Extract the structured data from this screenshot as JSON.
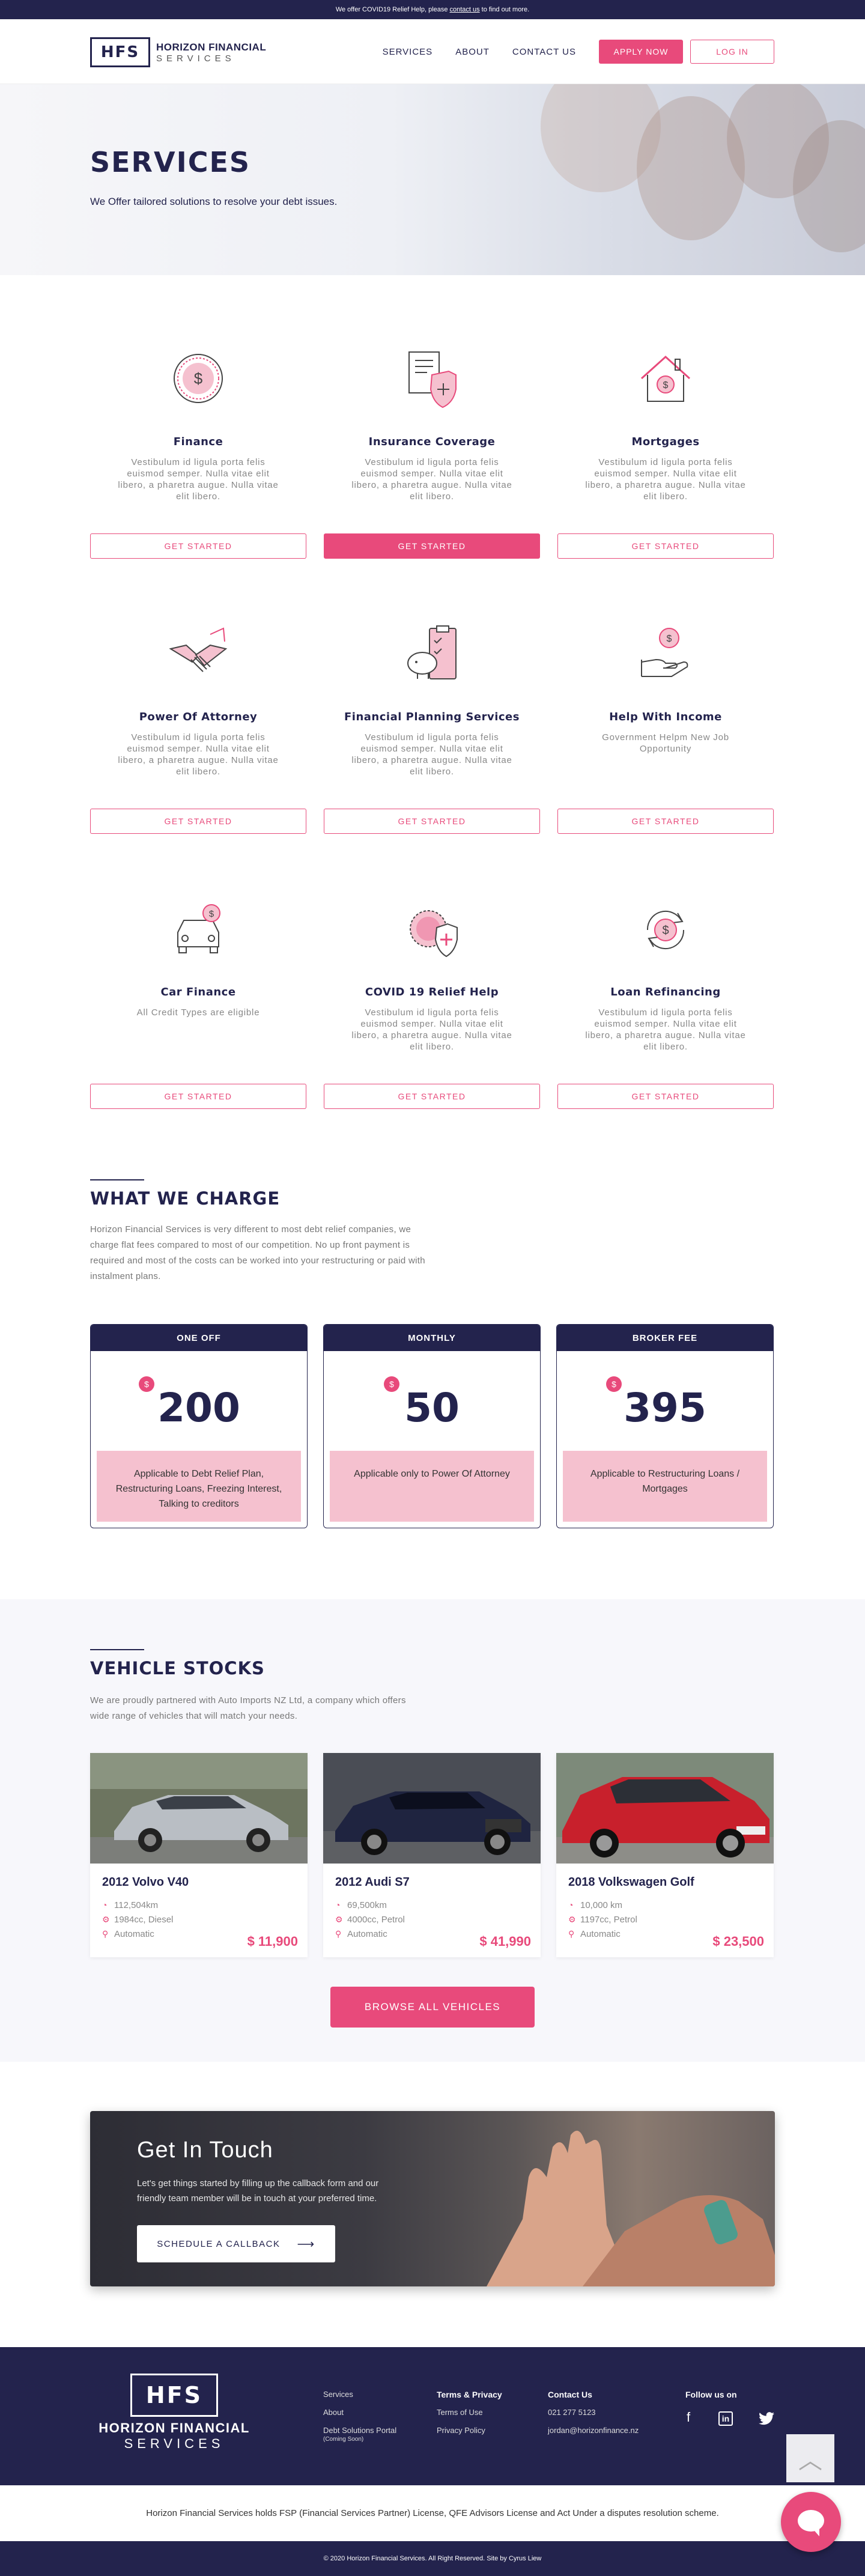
{
  "topbar": {
    "pre": "We offer COVID19 Relief Help, please",
    "link": "contact us",
    "post": "to find out more."
  },
  "header": {
    "logo_mark": "HFS",
    "logo_line1": "HORIZON FINANCIAL",
    "logo_line2": "SERVICES",
    "nav": [
      "SERVICES",
      "ABOUT",
      "CONTACT US"
    ],
    "apply": "APPLY NOW",
    "login": "LOG IN"
  },
  "hero": {
    "title": "SERVICES",
    "subtitle": "We Offer tailored solutions to resolve your debt issues."
  },
  "services": [
    {
      "title": "Finance",
      "text": "Vestibulum id ligula porta felis euismod semper. Nulla vitae elit libero, a pharetra augue. Nulla vitae elit libero.",
      "button": "GET STARTED",
      "icon": "coin-dollar-icon"
    },
    {
      "title": "Insurance Coverage",
      "text": "Vestibulum id ligula porta felis euismod semper. Nulla vitae elit libero, a pharetra augue. Nulla vitae elit libero.",
      "button": "GET STARTED",
      "icon": "insurance-shield-icon"
    },
    {
      "title": "Mortgages",
      "text": "Vestibulum id ligula porta felis euismod semper. Nulla vitae elit libero, a pharetra augue. Nulla vitae elit libero.",
      "button": "GET STARTED",
      "icon": "house-dollar-icon"
    },
    {
      "title": "Power Of Attorney",
      "text": "Vestibulum id ligula porta felis euismod semper. Nulla vitae elit libero, a pharetra augue. Nulla vitae elit libero.",
      "button": "GET STARTED",
      "icon": "handshake-icon"
    },
    {
      "title": "Financial Planning Services",
      "text": "Vestibulum id ligula porta felis euismod semper. Nulla vitae elit libero, a pharetra augue. Nulla vitae elit libero.",
      "button": "GET STARTED",
      "icon": "clipboard-piggy-icon"
    },
    {
      "title": "Help With Income",
      "text": "Government Helpm New Job Opportunity",
      "button": "GET STARTED",
      "icon": "hand-coin-icon"
    },
    {
      "title": "Car Finance",
      "text": "All Credit Types are eligible",
      "button": "GET STARTED",
      "icon": "car-dollar-icon"
    },
    {
      "title": "COVID 19 Relief Help",
      "text": "Vestibulum id ligula porta felis euismod semper. Nulla vitae elit libero, a pharetra augue. Nulla vitae elit libero.",
      "button": "GET STARTED",
      "icon": "virus-shield-icon"
    },
    {
      "title": "Loan Refinancing",
      "text": "Vestibulum id ligula porta felis euismod semper. Nulla vitae elit libero, a pharetra augue. Nulla vitae elit libero.",
      "button": "GET STARTED",
      "icon": "refresh-dollar-icon"
    }
  ],
  "charge": {
    "title": "WHAT WE CHARGE",
    "text": "Horizon Financial Services is very different to most debt relief companies, we charge flat fees compared to most of our competition. No up front payment is required and most of the costs can be worked into your restructuring or paid with instalment plans.",
    "currency": "$",
    "plans": [
      {
        "name": "ONE OFF",
        "amount": "200",
        "note": "Applicable to Debt Relief Plan, Restructuring Loans, Freezing Interest, Talking to creditors"
      },
      {
        "name": "MONTHLY",
        "amount": "50",
        "note": "Applicable only to Power Of Attorney"
      },
      {
        "name": "BROKER FEE",
        "amount": "395",
        "note": "Applicable to Restructuring Loans / Mortgages"
      }
    ]
  },
  "vehicles": {
    "title": "VEHICLE STOCKS",
    "text": "We are proudly partnered with Auto Imports NZ Ltd, a company which offers wide range of vehicles that will match your needs.",
    "browse": "BROWSE ALL VEHICLES",
    "cars": [
      {
        "name": "2012 Volvo V40",
        "km": "112,504km",
        "engine": "1984cc, Diesel",
        "trans": "Automatic",
        "price": "$ 11,900",
        "color": "#b9bec4"
      },
      {
        "name": "2012 Audi S7",
        "km": "69,500km",
        "engine": "4000cc, Petrol",
        "trans": "Automatic",
        "price": "$ 41,990",
        "color": "#1f2440"
      },
      {
        "name": "2018 Volkswagen Golf",
        "km": "10,000 km",
        "engine": "1197cc, Petrol",
        "trans": "Automatic",
        "price": "$ 23,500",
        "color": "#c8202c"
      }
    ]
  },
  "contact": {
    "title": "Get In Touch",
    "text": "Let's get things started by filling up the callback form and our friendly team member will be in touch at your preferred time.",
    "button": "SCHEDULE A CALLBACK"
  },
  "footer": {
    "logo_mark": "HFS",
    "logo_line1": "HORIZON FINANCIAL",
    "logo_line2": "SERVICES",
    "col1": [
      "Services",
      "About",
      "Debt Solutions Portal"
    ],
    "col1_note": "(Coming Soon)",
    "col2_title": "Terms & Privacy",
    "col2": [
      "Terms of Use",
      "Privacy Policy"
    ],
    "col3_title": "Contact Us",
    "col3": [
      "021 277 5123",
      "jordan@horizonfinance.nz"
    ],
    "follow": "Follow us on",
    "social": [
      "facebook-icon",
      "linkedin-icon",
      "twitter-icon"
    ],
    "disclaimer": "Horizon Financial Services holds FSP (Financial Services Partner) License, QFE Advisors License and Act Under a disputes resolution scheme.",
    "copyright": "© 2020 Horizon Financial Services. All Right Reserved. Site by Cyrus Liew"
  },
  "colors": {
    "navy": "#23234d",
    "pink": "#e84a7b",
    "pink_light": "#f5c1cf"
  }
}
